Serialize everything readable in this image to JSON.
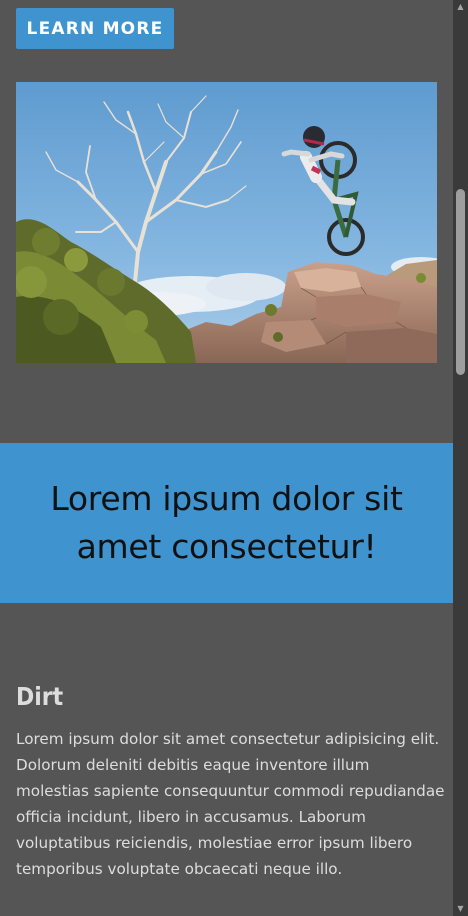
{
  "cta": {
    "label": "LEARN MORE"
  },
  "hero": {
    "image_subject": "mountain-biker-jumping-rocks-photo"
  },
  "banner": {
    "headline": "Lorem ipsum dolor sit amet consectetur!"
  },
  "section": {
    "title": "Dirt",
    "body": "Lorem ipsum dolor sit amet consectetur adipisicing elit. Dolorum deleniti debitis eaque inventore illum molestias sapiente consequuntur commodi repudiandae officia incidunt, libero in accusamus. Laborum voluptatibus reiciendis, molestiae error ipsum libero temporibus voluptate obcaecati neque illo."
  },
  "scrollbar": {
    "up_icon": "triangle-up-icon",
    "down_icon": "triangle-down-icon"
  },
  "colors": {
    "page_background": "#555555",
    "accent": "#3f94cf",
    "banner_text": "#111111",
    "body_text": "#dddddd"
  }
}
